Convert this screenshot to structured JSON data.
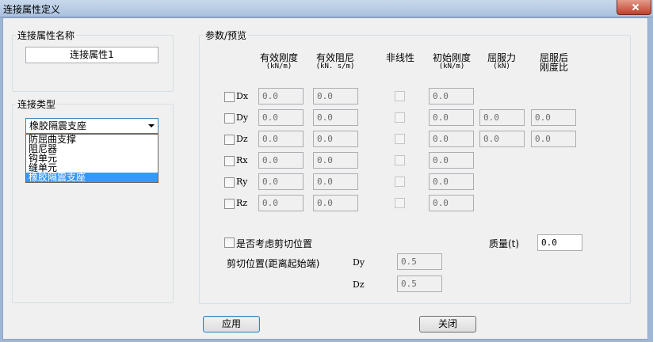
{
  "window": {
    "title": "连接属性定义"
  },
  "name_group": {
    "label": "连接属性名称",
    "value": "连接属性1"
  },
  "type_group": {
    "label": "连接类型",
    "selected": "橡胶隔震支座",
    "options": [
      "防屈曲支撑",
      "阻尼器",
      "钩单元",
      "缝单元",
      "橡胶隔震支座"
    ]
  },
  "params": {
    "label": "参数/预览",
    "headers": {
      "stiffness": "有效刚度",
      "stiffness_unit": "(kN/m)",
      "damping": "有效阻尼",
      "damping_unit": "(kN. s/m)",
      "nonlinear": "非线性",
      "init_stiffness": "初始刚度",
      "init_stiffness_unit": "(kN/m)",
      "yield": "屈服力",
      "yield_unit": "(kN)",
      "post_yield": "屈服后",
      "post_yield2": "刚度比"
    },
    "rows": [
      {
        "label": "Dx",
        "stiffness": "0.0",
        "damping": "0.0",
        "init": "0.0"
      },
      {
        "label": "Dy",
        "stiffness": "0.0",
        "damping": "0.0",
        "init": "0.0",
        "yield": "0.0",
        "ratio": "0.0"
      },
      {
        "label": "Dz",
        "stiffness": "0.0",
        "damping": "0.0",
        "init": "0.0",
        "yield": "0.0",
        "ratio": "0.0"
      },
      {
        "label": "Rx",
        "stiffness": "0.0",
        "damping": "0.0",
        "init": "0.0"
      },
      {
        "label": "Ry",
        "stiffness": "0.0",
        "damping": "0.0",
        "init": "0.0"
      },
      {
        "label": "Rz",
        "stiffness": "0.0",
        "damping": "0.0",
        "init": "0.0"
      }
    ],
    "shear_checkbox": "是否考虑剪切位置",
    "mass_label": "质量(t)",
    "mass_value": "0.0",
    "shear_pos_label": "剪切位置(距离起始端)",
    "dy_label": "Dy",
    "dy_value": "0.5",
    "dz_label": "Dz",
    "dz_value": "0.5"
  },
  "buttons": {
    "apply": "应用",
    "close": "关闭"
  }
}
